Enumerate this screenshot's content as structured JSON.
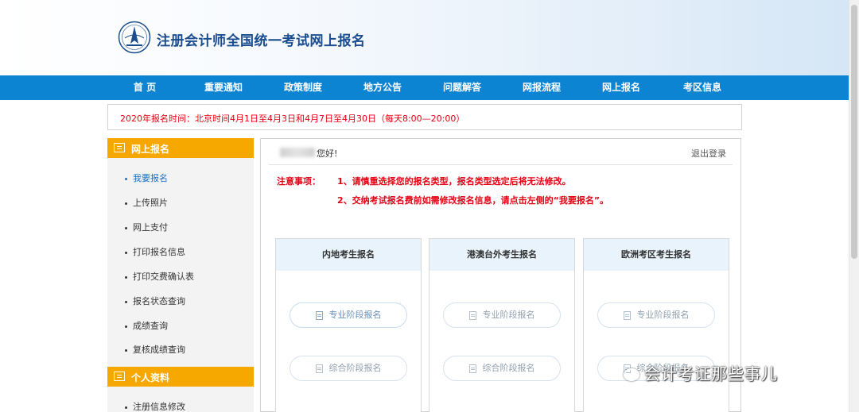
{
  "header": {
    "title": "注册会计师全国统一考试网上报名"
  },
  "nav": {
    "items": [
      "首 页",
      "重要通知",
      "政策制度",
      "地方公告",
      "问题解答",
      "网报流程",
      "网上报名",
      "考区信息"
    ]
  },
  "notice": {
    "text": "2020年报名时间：北京时间4月1日至4月3日和4月7日至4月30日（每天8:00—20:00）"
  },
  "sidebar": {
    "sections": [
      {
        "title": "网上报名",
        "items": [
          "我要报名",
          "上传照片",
          "网上支付",
          "打印报名信息",
          "打印交费确认表",
          "报名状态查询",
          "成绩查询",
          "复核成绩查询"
        ],
        "active": "我要报名"
      },
      {
        "title": "个人资料",
        "items": [
          "注册信息修改"
        ]
      }
    ]
  },
  "main": {
    "greeting": "您好!",
    "logout": "退出登录",
    "notes_label": "注意事项：",
    "notes": [
      "1、请慎重选择您的报名类型，报名类型选定后将无法修改。",
      "2、交纳考试报名费前如需修改报名信息，请点击左侧的“我要报名”。"
    ],
    "cards": [
      {
        "title": "内地考生报名",
        "buttons": [
          "专业阶段报名",
          "综合阶段报名"
        ]
      },
      {
        "title": "港澳台外考生报名",
        "buttons": [
          "专业阶段报名",
          "综合阶段报名"
        ]
      },
      {
        "title": "欧洲考区考生报名",
        "buttons": [
          "专业阶段报名",
          "综合阶段报名"
        ]
      }
    ]
  },
  "watermark": {
    "text": "会计考证那些事儿"
  },
  "colors": {
    "nav_bg": "#0c84d2",
    "sidebar_header": "#f6a800",
    "notice_text": "#e60012",
    "card_header": "#e9f3fc"
  }
}
